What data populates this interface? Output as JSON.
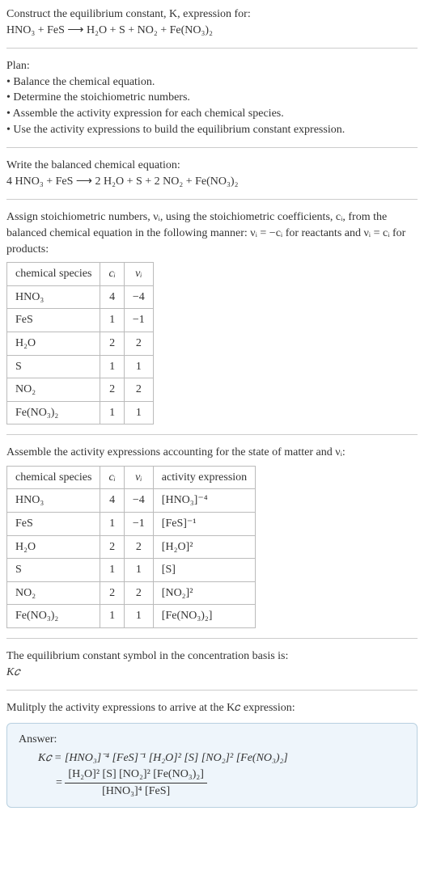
{
  "intro": {
    "line1": "Construct the equilibrium constant, K, expression for:",
    "eq1": "HNO₃ + FeS ⟶ H₂O + S + NO₂ + Fe(NO₃)₂"
  },
  "plan": {
    "title": "Plan:",
    "b1": "• Balance the chemical equation.",
    "b2": "• Determine the stoichiometric numbers.",
    "b3": "• Assemble the activity expression for each chemical species.",
    "b4": "• Use the activity expressions to build the equilibrium constant expression."
  },
  "balanced": {
    "t1": "Write the balanced chemical equation:",
    "eq": "4 HNO₃ + FeS ⟶ 2 H₂O + S + 2 NO₂ + Fe(NO₃)₂"
  },
  "assign": {
    "t1": "Assign stoichiometric numbers, νᵢ, using the stoichiometric coefficients, cᵢ, from the balanced chemical equation in the following manner: νᵢ = −cᵢ for reactants and νᵢ = cᵢ for products:"
  },
  "table1": {
    "h1": "chemical species",
    "h2": "cᵢ",
    "h3": "νᵢ",
    "r1c1": "HNO₃",
    "r1c2": "4",
    "r1c3": "−4",
    "r2c1": "FeS",
    "r2c2": "1",
    "r2c3": "−1",
    "r3c1": "H₂O",
    "r3c2": "2",
    "r3c3": "2",
    "r4c1": "S",
    "r4c2": "1",
    "r4c3": "1",
    "r5c1": "NO₂",
    "r5c2": "2",
    "r5c3": "2",
    "r6c1": "Fe(NO₃)₂",
    "r6c2": "1",
    "r6c3": "1"
  },
  "assemble": {
    "t1": "Assemble the activity expressions accounting for the state of matter and νᵢ:"
  },
  "table2": {
    "h1": "chemical species",
    "h2": "cᵢ",
    "h3": "νᵢ",
    "h4": "activity expression",
    "r1c1": "HNO₃",
    "r1c2": "4",
    "r1c3": "−4",
    "r1c4": "[HNO₃]⁻⁴",
    "r2c1": "FeS",
    "r2c2": "1",
    "r2c3": "−1",
    "r2c4": "[FeS]⁻¹",
    "r3c1": "H₂O",
    "r3c2": "2",
    "r3c3": "2",
    "r3c4": "[H₂O]²",
    "r4c1": "S",
    "r4c2": "1",
    "r4c3": "1",
    "r4c4": "[S]",
    "r5c1": "NO₂",
    "r5c2": "2",
    "r5c3": "2",
    "r5c4": "[NO₂]²",
    "r6c1": "Fe(NO₃)₂",
    "r6c2": "1",
    "r6c3": "1",
    "r6c4": "[Fe(NO₃)₂]"
  },
  "kc_symbol": {
    "t1": "The equilibrium constant symbol in the concentration basis is:",
    "t2": "K𝑐"
  },
  "multiply": {
    "t1": "Mulitply the activity expressions to arrive at the K𝑐 expression:"
  },
  "answer": {
    "label": "Answer:",
    "line1": "K𝑐 = [HNO₃]⁻⁴ [FeS]⁻¹ [H₂O]² [S] [NO₂]² [Fe(NO₃)₂]",
    "eq_prefix": "= ",
    "frac_num": "[H₂O]² [S] [NO₂]² [Fe(NO₃)₂]",
    "frac_den": "[HNO₃]⁴ [FeS]"
  }
}
